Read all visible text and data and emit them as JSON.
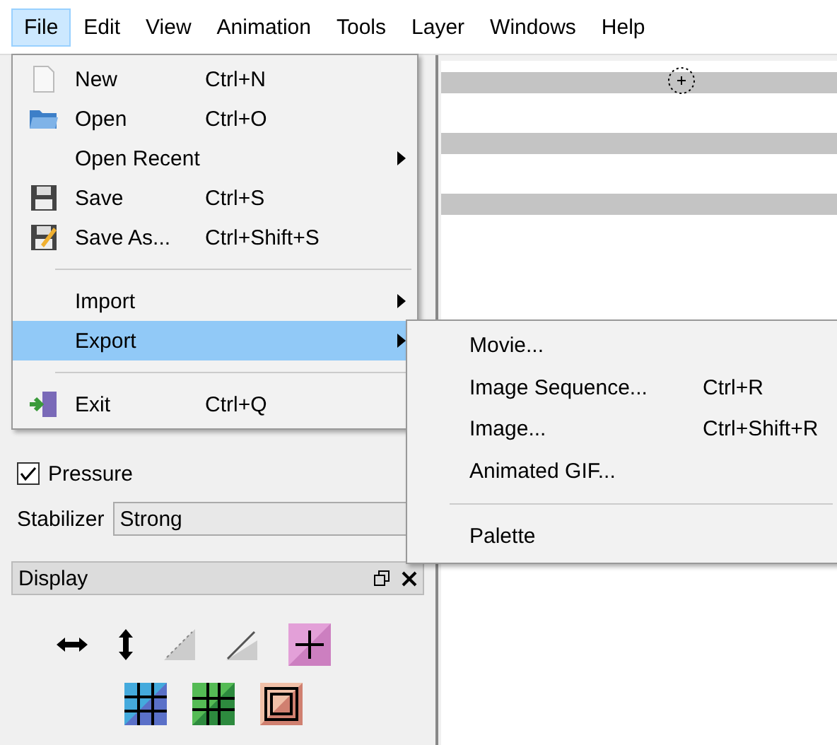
{
  "menubar": [
    {
      "label": "File",
      "selected": true
    },
    {
      "label": "Edit",
      "selected": false
    },
    {
      "label": "View",
      "selected": false
    },
    {
      "label": "Animation",
      "selected": false
    },
    {
      "label": "Tools",
      "selected": false
    },
    {
      "label": "Layer",
      "selected": false
    },
    {
      "label": "Windows",
      "selected": false
    },
    {
      "label": "Help",
      "selected": false
    }
  ],
  "file_menu": {
    "items": [
      {
        "kind": "item",
        "label": "New",
        "shortcut": "Ctrl+N",
        "submenu": false,
        "selected": false
      },
      {
        "kind": "item",
        "label": "Open",
        "shortcut": "Ctrl+O",
        "submenu": false,
        "selected": false
      },
      {
        "kind": "item",
        "label": "Open Recent",
        "submenu": true,
        "selected": false
      },
      {
        "kind": "item",
        "label": "Save",
        "shortcut": "Ctrl+S",
        "submenu": false,
        "selected": false
      },
      {
        "kind": "item",
        "label": "Save As...",
        "shortcut": "Ctrl+Shift+S",
        "submenu": false,
        "selected": false
      },
      {
        "kind": "separator"
      },
      {
        "kind": "item",
        "label": "Import",
        "submenu": true,
        "selected": false
      },
      {
        "kind": "item",
        "label": "Export",
        "submenu": true,
        "selected": true
      },
      {
        "kind": "separator"
      },
      {
        "kind": "item",
        "label": "Exit",
        "shortcut": "Ctrl+Q",
        "submenu": false,
        "selected": false
      }
    ]
  },
  "export_menu": {
    "items": [
      {
        "kind": "item",
        "label": "Movie...",
        "submenu": false,
        "selected": false
      },
      {
        "kind": "item",
        "label": "Image Sequence...",
        "shortcut": "Ctrl+R",
        "submenu": false,
        "selected": false
      },
      {
        "kind": "item",
        "label": "Image...",
        "shortcut": "Ctrl+Shift+R",
        "submenu": false,
        "selected": false
      },
      {
        "kind": "item",
        "label": "Animated GIF...",
        "submenu": false,
        "selected": false
      },
      {
        "kind": "separator"
      },
      {
        "kind": "item",
        "label": "Palette",
        "submenu": false,
        "selected": false
      }
    ]
  },
  "tool_options": {
    "pressure": {
      "label": "Pressure",
      "checked": true
    },
    "stabilizer": {
      "label": "Stabilizer",
      "value": "Strong"
    }
  },
  "display_panel": {
    "title": "Display"
  }
}
